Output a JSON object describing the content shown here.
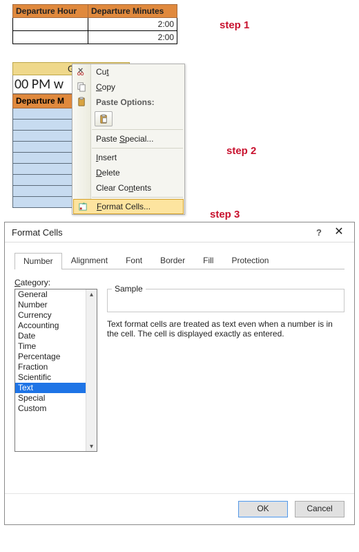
{
  "steps": {
    "s1": "step 1",
    "s2": "step 2",
    "s3": "step 3"
  },
  "table1": {
    "headers": {
      "h1": "Departure Hour",
      "h2": "Departure Minutes"
    },
    "rows": [
      {
        "c1": "",
        "c2": "2:00"
      },
      {
        "c1": "",
        "c2": "2:00"
      }
    ]
  },
  "column": {
    "letter": "G",
    "formula_cell": "00 PM w",
    "sel_header": "Departure M"
  },
  "context_menu": {
    "cut": "Cut",
    "copy": "Copy",
    "paste_options": "Paste Options:",
    "paste_special": "Paste Special...",
    "insert": "Insert",
    "delete": "Delete",
    "clear_contents": "Clear Contents",
    "format_cells": "Format Cells..."
  },
  "dialog": {
    "title": "Format Cells",
    "help": "?",
    "close": "✕",
    "tabs": {
      "number": "Number",
      "alignment": "Alignment",
      "font": "Font",
      "border": "Border",
      "fill": "Fill",
      "protection": "Protection"
    },
    "category_label": "Category:",
    "categories": [
      "General",
      "Number",
      "Currency",
      "Accounting",
      "Date",
      "Time",
      "Percentage",
      "Fraction",
      "Scientific",
      "Text",
      "Special",
      "Custom"
    ],
    "selected_category_index": 9,
    "sample_label": "Sample",
    "description": "Text format cells are treated as text even when a number is in the cell. The cell is displayed exactly as entered.",
    "ok": "OK",
    "cancel": "Cancel"
  },
  "icons": {
    "cut": "cut-icon",
    "copy": "copy-icon",
    "paste": "paste-icon",
    "format": "format-cells-icon"
  }
}
